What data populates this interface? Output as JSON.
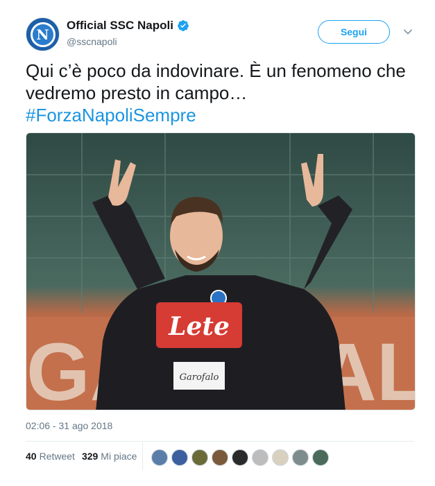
{
  "account": {
    "display_name": "Official SSC Napoli",
    "handle": "@sscnapoli",
    "avatar_letter": "N",
    "verified": true
  },
  "follow_button": {
    "label": "Segui"
  },
  "tweet": {
    "text_main": "Qui c’è poco da indovinare. È un fenomeno che vedremo presto in campo…",
    "hashtag": "#ForzaNapoliSempre",
    "timestamp": "02:06 - 31 ago 2018"
  },
  "media": {
    "jersey_sponsor": "Lete",
    "patch_text": "Garofalo",
    "banner_text": "GAROFALO"
  },
  "stats": {
    "retweets_count": "40",
    "retweets_label": "Retweet",
    "likes_count": "329",
    "likes_label": "Mi piace"
  },
  "likers": [
    {
      "color": "#5a7ea8"
    },
    {
      "color": "#3c5fa0"
    },
    {
      "color": "#6b6b3a"
    },
    {
      "color": "#7a5a3a"
    },
    {
      "color": "#2b2b2b"
    },
    {
      "color": "#bdbdbd"
    },
    {
      "color": "#d9d0c0"
    },
    {
      "color": "#7f8c8d"
    },
    {
      "color": "#4a6a5a"
    }
  ],
  "colors": {
    "brand_blue": "#1da1f2",
    "hashtag_blue": "#1b95e0",
    "muted_text": "#657786"
  }
}
